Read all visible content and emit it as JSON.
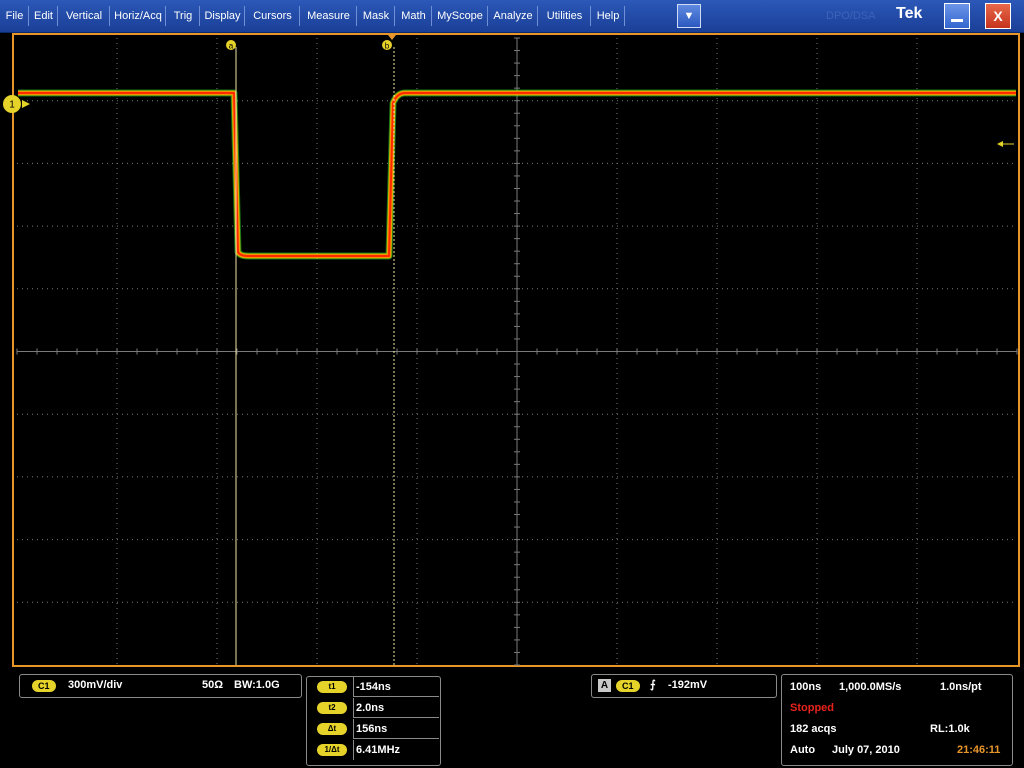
{
  "menubar": {
    "items": [
      "File",
      "Edit",
      "Vertical",
      "Horiz/Acq",
      "Trig",
      "Display",
      "Cursors",
      "Measure",
      "Mask",
      "Math",
      "MyScope",
      "Analyze",
      "Utilities",
      "Help"
    ],
    "dropdown_glyph": "▼",
    "watermark": "DPO/DSA",
    "brand": "Tek",
    "minimize_icon": "minimize-icon",
    "close_glyph": "X"
  },
  "graticule": {
    "cursor_a_label": "a",
    "cursor_b_label": "b",
    "channel_marker_label": "1",
    "trace_colors": [
      "#ff2a00",
      "#ff8a00",
      "#ffe000",
      "#29d22a"
    ],
    "grid_color": "#7a7a7a",
    "frame_color": "#e8962a"
  },
  "channel": {
    "badge": "C1",
    "scale": "300mV/div",
    "impedance": "50Ω",
    "bandwidth": "BW:1.0G"
  },
  "cursors": [
    {
      "label": "t1",
      "value": "-154ns"
    },
    {
      "label": "t2",
      "value": "2.0ns"
    },
    {
      "label": "Δt",
      "value": "156ns"
    },
    {
      "label": "1/Δt",
      "value": "6.41MHz"
    }
  ],
  "trigger": {
    "source_box": "A",
    "channel": "C1",
    "slope_glyph": "⨍",
    "level": "-192mV"
  },
  "acquisition": {
    "time_div": "100ns",
    "sample_rate": "1,000.0MS/s",
    "resolution": "1.0ns/pt",
    "status": "Stopped",
    "acqs": "182 acqs",
    "record_length": "RL:1.0k",
    "mode": "Auto",
    "date": "July 07, 2010",
    "time": "21:46:11"
  }
}
